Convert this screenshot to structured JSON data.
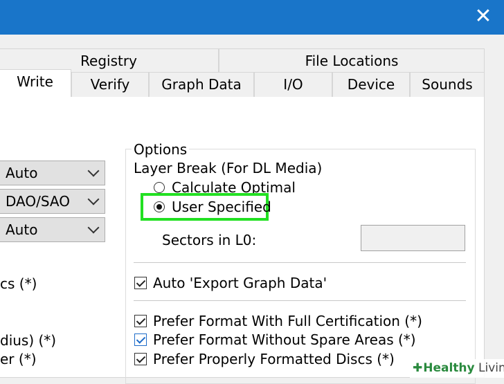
{
  "window": {
    "close_glyph": "✕"
  },
  "tabs_row1": [
    {
      "label": "Registry"
    },
    {
      "label": "File Locations"
    }
  ],
  "tabs_row2": [
    {
      "label": "Write"
    },
    {
      "label": "Verify"
    },
    {
      "label": "Graph Data"
    },
    {
      "label": "I/O"
    },
    {
      "label": "Device"
    },
    {
      "label": "Sounds"
    }
  ],
  "left_selects": [
    {
      "value": "Auto"
    },
    {
      "value": "DAO/SAO"
    },
    {
      "value": "Auto"
    }
  ],
  "left_partial_labels": [
    "cs (*)",
    "dius) (*)",
    "er (*)"
  ],
  "options": {
    "title": "Options",
    "layer_break_label": "Layer Break (For DL Media)",
    "radio_calculate": "Calculate Optimal",
    "radio_user": "User Specified",
    "selected_radio": "User Specified",
    "sectors_label": "Sectors in L0:",
    "sectors_value": "",
    "checkboxes": [
      {
        "label": "Auto 'Export Graph Data'",
        "checked": true
      },
      {
        "label": "Prefer Format With Full Certification (*)",
        "checked": true
      },
      {
        "label": "Prefer Format Without Spare Areas (*)",
        "checked": true
      },
      {
        "label": "Prefer Properly Formatted Discs (*)",
        "checked": true
      }
    ]
  },
  "watermark": {
    "prefix": "Healthy",
    "suffix": " Living"
  },
  "colors": {
    "titlebar": "#1975c9",
    "highlight": "#22e022",
    "watermark_green": "#2a8a3e"
  }
}
